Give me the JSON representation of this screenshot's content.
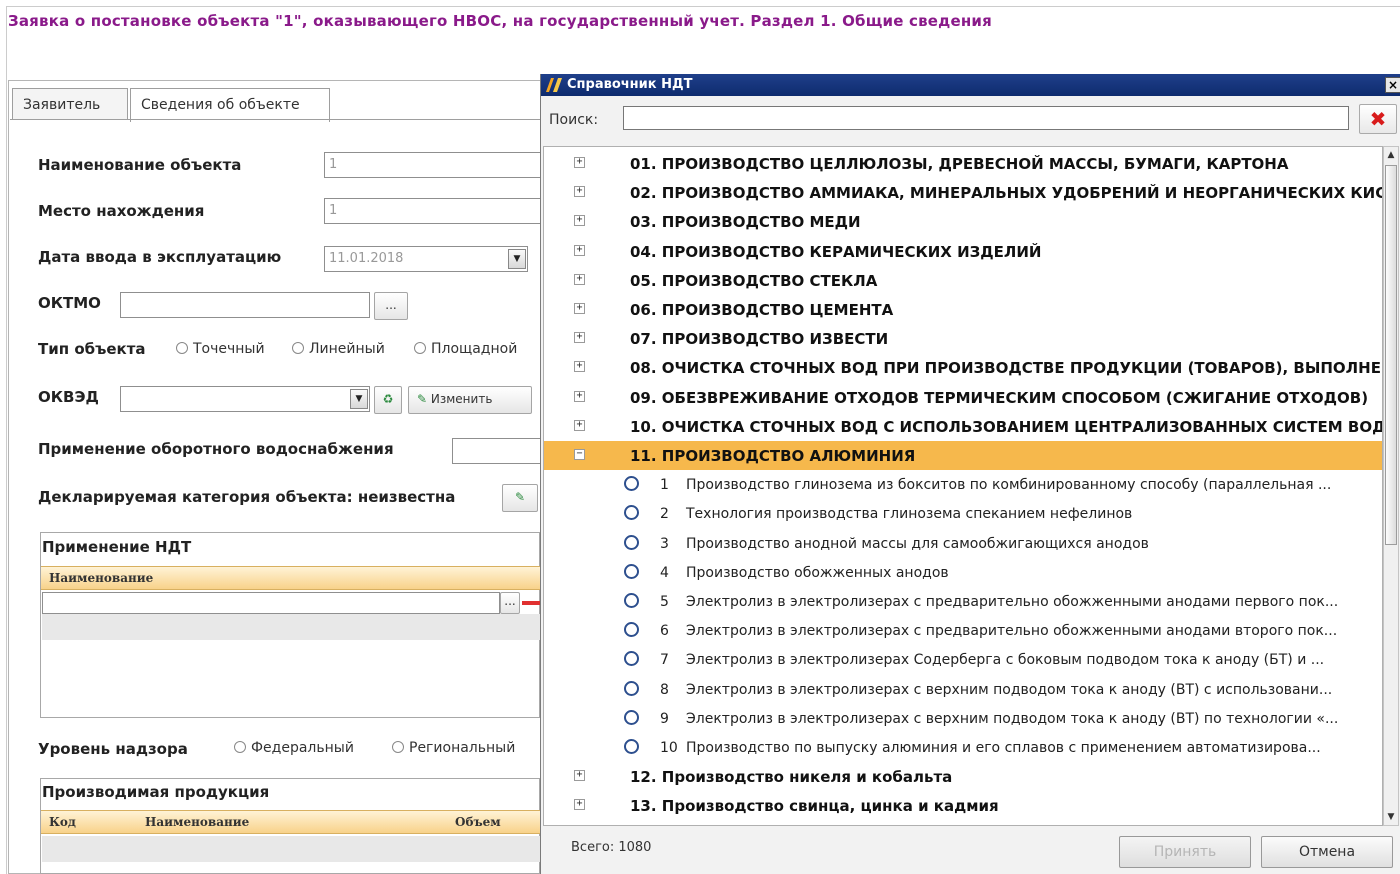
{
  "page": {
    "title": "Заявка о постановке объекта \"1\", оказывающего НВОС, на государственный учет. Раздел 1. Общие сведения"
  },
  "tabs": [
    {
      "label": "Заявитель"
    },
    {
      "label": "Сведения об объекте"
    }
  ],
  "form": {
    "name_label": "Наименование объекта",
    "name_value": "1",
    "location_label": "Место нахождения",
    "location_value": "1",
    "date_label": "Дата ввода в эксплуатацию",
    "date_value": "11.01.2018",
    "oktmo_label": "ОКТМО",
    "oktmo_btn": "...",
    "type_label": "Тип объекта",
    "type_options": [
      "Точечный",
      "Линейный",
      "Площадной"
    ],
    "okved_label": "ОКВЭД",
    "change_btn": "Изменить",
    "water_label": "Применение оборотного водоснабжения",
    "category_label": "Декларируемая категория объекта: неизвестна",
    "ndt_section": "Применение НДТ",
    "ndt_col_name": "Наименование",
    "supervision_label": "Уровень надзора",
    "supervision_options": [
      "Федеральный",
      "Региональный"
    ],
    "products_section": "Производимая продукция",
    "products_cols": [
      "Код",
      "Наименование",
      "Объем"
    ]
  },
  "dialog": {
    "title": "Справочник НДТ",
    "close": "×",
    "search_label": "Поиск:",
    "clear": "✖",
    "categories_top": [
      {
        "label": "01. ПРОИЗВОДСТВО ЦЕЛЛЮЛОЗЫ, ДРЕВЕСНОЙ МАССЫ, БУМАГИ, КАРТОНА",
        "exp": "+"
      },
      {
        "label": "02. ПРОИЗВОДСТВО АММИАКА, МИНЕРАЛЬНЫХ УДОБРЕНИЙ И НЕОРГАНИЧЕСКИХ КИС...",
        "exp": "+"
      },
      {
        "label": "03. ПРОИЗВОДСТВО МЕДИ",
        "exp": "+"
      },
      {
        "label": "04. ПРОИЗВОДСТВО КЕРАМИЧЕСКИХ ИЗДЕЛИЙ",
        "exp": "+"
      },
      {
        "label": "05. ПРОИЗВОДСТВО СТЕКЛА",
        "exp": "+"
      },
      {
        "label": "06. ПРОИЗВОДСТВО ЦЕМЕНТА",
        "exp": "+"
      },
      {
        "label": "07. ПРОИЗВОДСТВО ИЗВЕСТИ",
        "exp": "+"
      },
      {
        "label": "08. ОЧИСТКА СТОЧНЫХ ВОД ПРИ ПРОИЗВОДСТВЕ ПРОДУКЦИИ (ТОВАРОВ), ВЫПОЛНЕ...",
        "exp": "+"
      },
      {
        "label": "09. ОБЕЗВРЕЖИВАНИЕ ОТХОДОВ ТЕРМИЧЕСКИМ СПОСОБОМ (СЖИГАНИЕ ОТХОДОВ)",
        "exp": "+"
      },
      {
        "label": "10. ОЧИСТКА СТОЧНЫХ ВОД С ИСПОЛЬЗОВАНИЕМ ЦЕНТРАЛИЗОВАННЫХ СИСТЕМ ВОД...",
        "exp": "+"
      },
      {
        "label": "11. ПРОИЗВОДСТВО АЛЮМИНИЯ",
        "exp": "−"
      }
    ],
    "subitems": [
      {
        "num": "1",
        "label": "Производство глинозема из бокситов по комбинированному способу (параллельная ..."
      },
      {
        "num": "2",
        "label": "Технология производства глинозема спеканием нефелинов"
      },
      {
        "num": "3",
        "label": "Производство анодной массы для самообжигающихся анодов"
      },
      {
        "num": "4",
        "label": "Производство обожженных анодов"
      },
      {
        "num": "5",
        "label": "Электролиз в электролизерах с предварительно обожженными анодами первого пок..."
      },
      {
        "num": "6",
        "label": "Электролиз в электролизерах с предварительно обожженными анодами второго пок..."
      },
      {
        "num": "7",
        "label": "Электролиз в электролизерах Содерберга с боковым подводом тока к аноду (БТ) и ..."
      },
      {
        "num": "8",
        "label": "Электролиз в электролизерах с верхним подводом тока к аноду (ВТ) с использовани..."
      },
      {
        "num": "9",
        "label": "Электролиз в электролизерах с верхним подводом тока к аноду (ВТ) по технологии «..."
      },
      {
        "num": "10",
        "label": "Производство по выпуску алюминия и его сплавов с применением автоматизирова..."
      }
    ],
    "categories_bottom": [
      {
        "label": "12. Производство никеля и кобальта",
        "exp": "+"
      },
      {
        "label": "13. Производство свинца, цинка и кадмия",
        "exp": "+"
      }
    ],
    "total": "Всего: 1080",
    "accept_btn": "Принять",
    "cancel_btn": "Отмена"
  }
}
